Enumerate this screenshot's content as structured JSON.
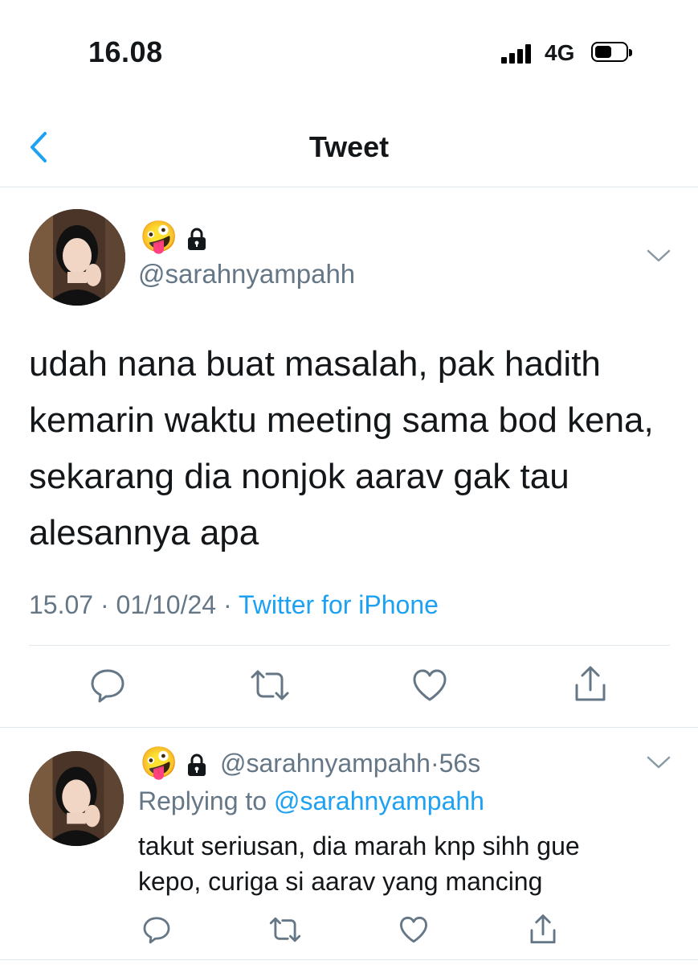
{
  "status_bar": {
    "time": "16.08",
    "network": "4G"
  },
  "nav": {
    "title": "Tweet"
  },
  "tweet": {
    "handle": "@sarahnyampahh",
    "emoji": "🤪",
    "text": "udah nana buat masalah, pak hadith kemarin waktu meeting sama bod kena, sekarang dia nonjok aarav gak tau alesannya apa",
    "time": "15.07",
    "date": "01/10/24",
    "source": "Twitter for iPhone",
    "separator": " · "
  },
  "reply": {
    "handle": "@sarahnyampahh",
    "age": "56s",
    "separator": "·",
    "emoji": "🤪",
    "replying_prefix": "Replying to ",
    "replying_to": "@sarahnyampahh",
    "text_line1": "takut seriusan, dia marah knp sihh gue",
    "text_line2": "kepo, curiga si aarav yang mancing"
  },
  "icons": {
    "back": "chevron-left-icon",
    "caret": "chevron-down-icon",
    "reply": "comment-icon",
    "retweet": "retweet-icon",
    "like": "heart-icon",
    "share": "share-icon",
    "lock": "lock-icon"
  },
  "colors": {
    "accent": "#1da1f2",
    "muted": "#657786",
    "text": "#14171a"
  }
}
